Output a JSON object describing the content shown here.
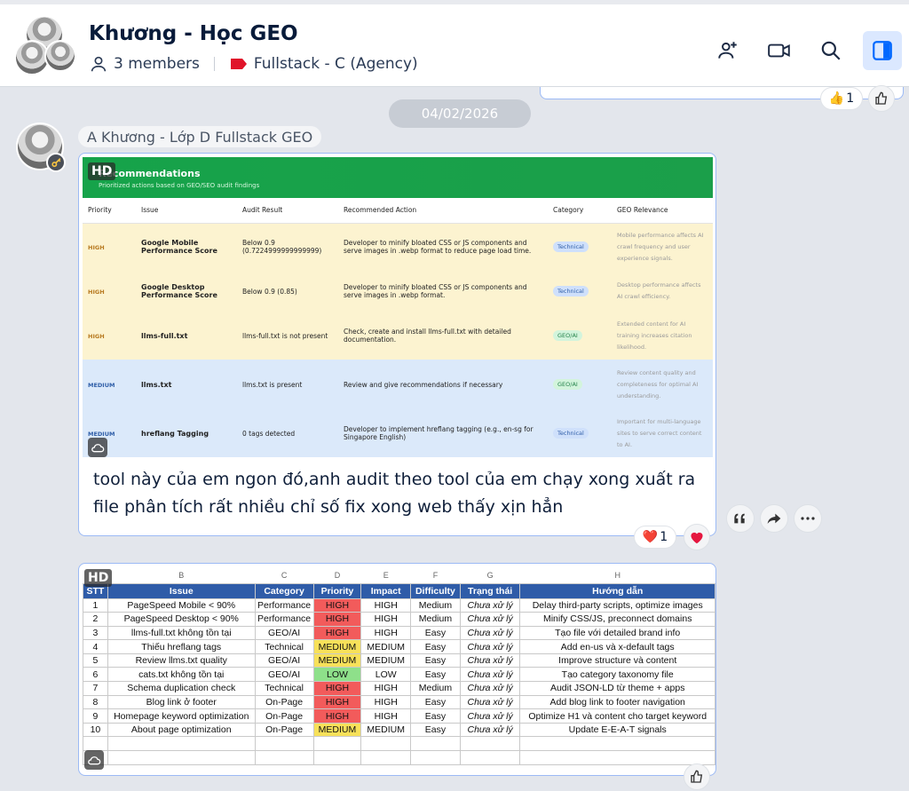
{
  "header": {
    "title": "Khương - Học GEO",
    "members": "3 members",
    "label": "Fullstack - C (Agency)"
  },
  "date_divider": "04/02/2026",
  "top_reaction": {
    "emoji": "👍",
    "count": "1"
  },
  "message": {
    "sender": "A Khương - Lớp D Fullstack GEO",
    "hd_badge": "HD",
    "image1": {
      "title": "Recommendations",
      "subtitle": "Prioritized actions based on GEO/SEO audit findings",
      "columns": [
        "Priority",
        "Issue",
        "Audit Result",
        "Recommended Action",
        "Category",
        "GEO Relevance"
      ],
      "rows": [
        {
          "priority": "HIGH",
          "issue": "Google Mobile Performance Score",
          "result": "Below 0.9 (0.7224999999999999)",
          "action": "Developer to minify bloated CSS or JS components and serve images in .webp format to reduce page load time.",
          "category": "Technical",
          "relevance": "Mobile performance affects AI crawl frequency and user experience signals."
        },
        {
          "priority": "HIGH",
          "issue": "Google Desktop Performance Score",
          "result": "Below 0.9 (0.85)",
          "action": "Developer to minify bloated CSS or JS components and serve images in .webp format.",
          "category": "Technical",
          "relevance": "Desktop performance affects AI crawl efficiency."
        },
        {
          "priority": "HIGH",
          "issue": "llms-full.txt",
          "result": "llms-full.txt is not present",
          "action": "Check, create and install llms-full.txt with detailed documentation.",
          "category": "GEO/AI",
          "relevance": "Extended content for AI training increases citation likelihood."
        },
        {
          "priority": "MEDIUM",
          "issue": "llms.txt",
          "result": "llms.txt is present",
          "action": "Review and give recommendations if necessary",
          "category": "GEO/AI",
          "relevance": "Review content quality and completeness for optimal AI understanding."
        },
        {
          "priority": "MEDIUM",
          "issue": "hreflang Tagging",
          "result": "0 tags detected",
          "action": "Developer to implement hreflang tagging (e.g., en-sg for Singapore English)",
          "category": "Technical",
          "relevance": "Important for multi-language sites to serve correct content to AI."
        }
      ]
    },
    "text": "tool này của em ngon đó,anh audit theo tool của em chạy xong xuất ra file phân tích rất nhiều chỉ số fix xong web thấy xịn hẳn",
    "reaction": {
      "emoji": "❤️",
      "count": "1"
    }
  },
  "sheet": {
    "col_letters": [
      "",
      "B",
      "C",
      "D",
      "E",
      "F",
      "G",
      "H"
    ],
    "headers": [
      "STT",
      "Issue",
      "Category",
      "Priority",
      "Impact",
      "Difficulty",
      "Trạng thái",
      "Hướng dẫn"
    ],
    "rows": [
      [
        "1",
        "PageSpeed Mobile < 90%",
        "Performance",
        "HIGH",
        "HIGH",
        "Medium",
        "Chưa xử lý",
        "Delay third-party scripts, optimize images"
      ],
      [
        "2",
        "PageSpeed Desktop < 90%",
        "Performance",
        "HIGH",
        "HIGH",
        "Medium",
        "Chưa xử lý",
        "Minify CSS/JS, preconnect domains"
      ],
      [
        "3",
        "llms-full.txt không tồn tại",
        "GEO/AI",
        "HIGH",
        "HIGH",
        "Easy",
        "Chưa xử lý",
        "Tạo file với detailed brand info"
      ],
      [
        "4",
        "Thiếu hreflang tags",
        "Technical",
        "MEDIUM",
        "MEDIUM",
        "Easy",
        "Chưa xử lý",
        "Add en-us và x-default tags"
      ],
      [
        "5",
        "Review llms.txt quality",
        "GEO/AI",
        "MEDIUM",
        "MEDIUM",
        "Easy",
        "Chưa xử lý",
        "Improve structure và content"
      ],
      [
        "6",
        "cats.txt không tồn tại",
        "GEO/AI",
        "LOW",
        "LOW",
        "Easy",
        "Chưa xử lý",
        "Tạo category taxonomy file"
      ],
      [
        "7",
        "Schema duplication check",
        "Technical",
        "HIGH",
        "HIGH",
        "Medium",
        "Chưa xử lý",
        "Audit JSON-LD từ theme + apps"
      ],
      [
        "8",
        "Blog link ở footer",
        "On-Page",
        "HIGH",
        "HIGH",
        "Easy",
        "Chưa xử lý",
        "Add blog link to footer navigation"
      ],
      [
        "9",
        "Homepage keyword optimization",
        "On-Page",
        "HIGH",
        "HIGH",
        "Easy",
        "Chưa xử lý",
        "Optimize H1 và content cho target keyword"
      ],
      [
        "10",
        "About page optimization",
        "On-Page",
        "MEDIUM",
        "MEDIUM",
        "Easy",
        "Chưa xử lý",
        "Update E-E-A-T signals"
      ]
    ]
  },
  "colors": {
    "accent": "#0068ff",
    "header_blue": "#2f5ca8",
    "high": "#f25b5b",
    "medium": "#f7e15a",
    "low": "#8ee08a"
  }
}
